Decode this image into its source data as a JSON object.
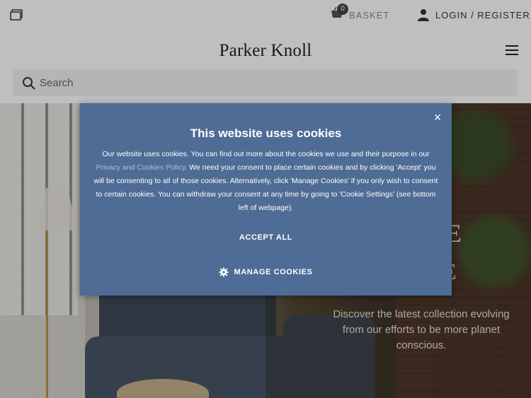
{
  "header": {
    "basket_count": "0",
    "basket_label": "BASKET",
    "login_label": "LOGIN / REGISTER",
    "brand": "Parker Knoll"
  },
  "search": {
    "placeholder": "Search"
  },
  "hero": {
    "text": "Discover the latest collection evolving from our efforts to be more planet conscious.",
    "headline_fragment_1": "E",
    "headline_fragment_2": "E"
  },
  "cookie_modal": {
    "title": "This website uses cookies",
    "body_before_link": "Our website uses cookies. You can find out more about the cookies we use and their purpose in our ",
    "link_text": "Privacy and Cookies Policy",
    "body_after_link": ". We need your consent to place certain cookies and by clicking 'Accept' you will be consenting to all of those cookies. Alternatively, click 'Manage Cookies' if you only wish to consent to certain cookies. You can withdraw your consent at any time by going to 'Cookie Settings' (see bottom left of webpage).",
    "accept_label": "ACCEPT ALL",
    "manage_label": "MANAGE COOKIES",
    "close_symbol": "×"
  },
  "colors": {
    "modal_bg": "#4f6c96",
    "link": "#a9bede"
  },
  "icons": {
    "window": "window-icon",
    "basket": "basket-icon",
    "user": "user-icon",
    "menu": "menu-icon",
    "search": "search-icon",
    "close": "close-icon",
    "gear": "gear-icon"
  }
}
